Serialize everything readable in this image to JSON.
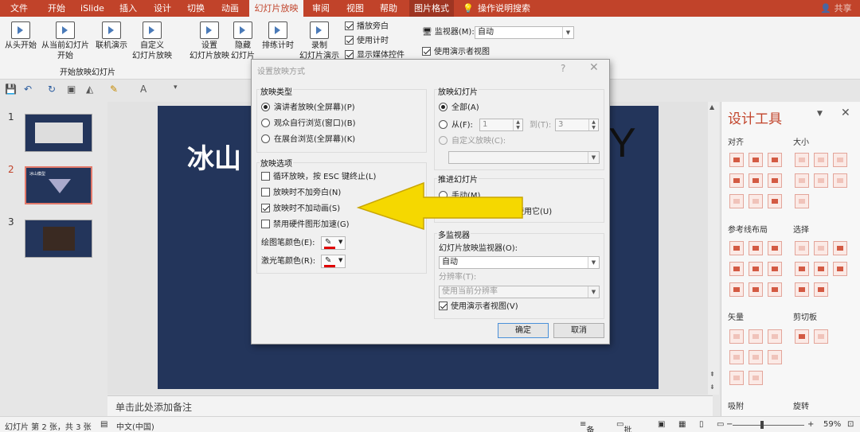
{
  "menu": {
    "tabs": [
      "文件",
      "开始",
      "iSlide",
      "插入",
      "设计",
      "切换",
      "动画",
      "幻灯片放映",
      "审阅",
      "视图",
      "帮助",
      "图片格式"
    ],
    "active": "幻灯片放映",
    "context_tab": "图片格式",
    "search": "操作说明搜索",
    "share": "共享"
  },
  "ribbon": {
    "buttons": {
      "from_start": "从头开始",
      "from_current_1": "从当前幻灯片",
      "from_current_2": "开始",
      "online_present": "联机演示",
      "custom_1": "自定义",
      "custom_2": "幻灯片放映",
      "setup_1": "设置",
      "setup_2": "幻灯片放映",
      "hide_1": "隐藏",
      "hide_2": "幻灯片",
      "rehearse": "排练计时",
      "record_1": "录制",
      "record_2": "幻灯片演示"
    },
    "group_label": "开始放映幻灯片",
    "checks": {
      "play_narration": "播放旁白",
      "use_timings": "使用计时",
      "show_media_controls": "显示媒体控件"
    },
    "monitor_label": "监视器(M):",
    "monitor_value": "自动",
    "presenter_view": "使用演示者视图"
  },
  "slides": {
    "numbers": [
      "1",
      "2",
      "3"
    ],
    "selected": "2",
    "thumb2_title": "冰山模型"
  },
  "slide": {
    "title": "冰山",
    "corner_letter": "Y"
  },
  "notes_placeholder": "单击此处添加备注",
  "design_panel": {
    "title": "设计工具",
    "sections": {
      "align": "对齐",
      "size": "大小",
      "guides": "参考线布局",
      "select": "选择",
      "vector": "矢量",
      "clipboard": "剪切板",
      "snap": "吸附",
      "rotate": "旋转"
    }
  },
  "status": {
    "slide_info": "幻灯片 第 2 张，共 3 张",
    "language": "中文(中国)",
    "notes": "备注",
    "comments": "批注",
    "zoom": "59%"
  },
  "dialog": {
    "title": "设置放映方式",
    "help": "?",
    "show_type": {
      "label": "放映类型",
      "options": [
        "演讲者放映(全屏幕)(P)",
        "观众自行浏览(窗口)(B)",
        "在展台浏览(全屏幕)(K)"
      ],
      "selected": 0
    },
    "show_options": {
      "label": "放映选项",
      "options": [
        "循环放映，按 ESC 键终止(L)",
        "放映时不加旁白(N)",
        "放映时不加动画(S)",
        "禁用硬件图形加速(G)"
      ],
      "checked": [
        false,
        false,
        true,
        false
      ],
      "pen_color_label": "绘图笔颜色(E):",
      "laser_color_label": "激光笔颜色(R):",
      "pen_color": "#e00000",
      "laser_color": "#e00000"
    },
    "show_slides": {
      "label": "放映幻灯片",
      "all": "全部(A)",
      "from": "从(F):",
      "from_value": "1",
      "to": "到(T):",
      "to_value": "3",
      "custom": "自定义放映(C):"
    },
    "advance": {
      "label": "推进幻灯片",
      "manual": "手动(M)",
      "timings_tail": "计时，则使用它(U)"
    },
    "multi_monitor": {
      "label": "多监视器",
      "monitor_label": "幻灯片放映监视器(O):",
      "monitor_value": "自动",
      "resolution_label": "分辨率(T):",
      "resolution_value": "使用当前分辨率",
      "presenter_view": "使用演示者视图(V)"
    },
    "ok": "确定",
    "cancel": "取消"
  },
  "arrow_color": "#f5d800"
}
